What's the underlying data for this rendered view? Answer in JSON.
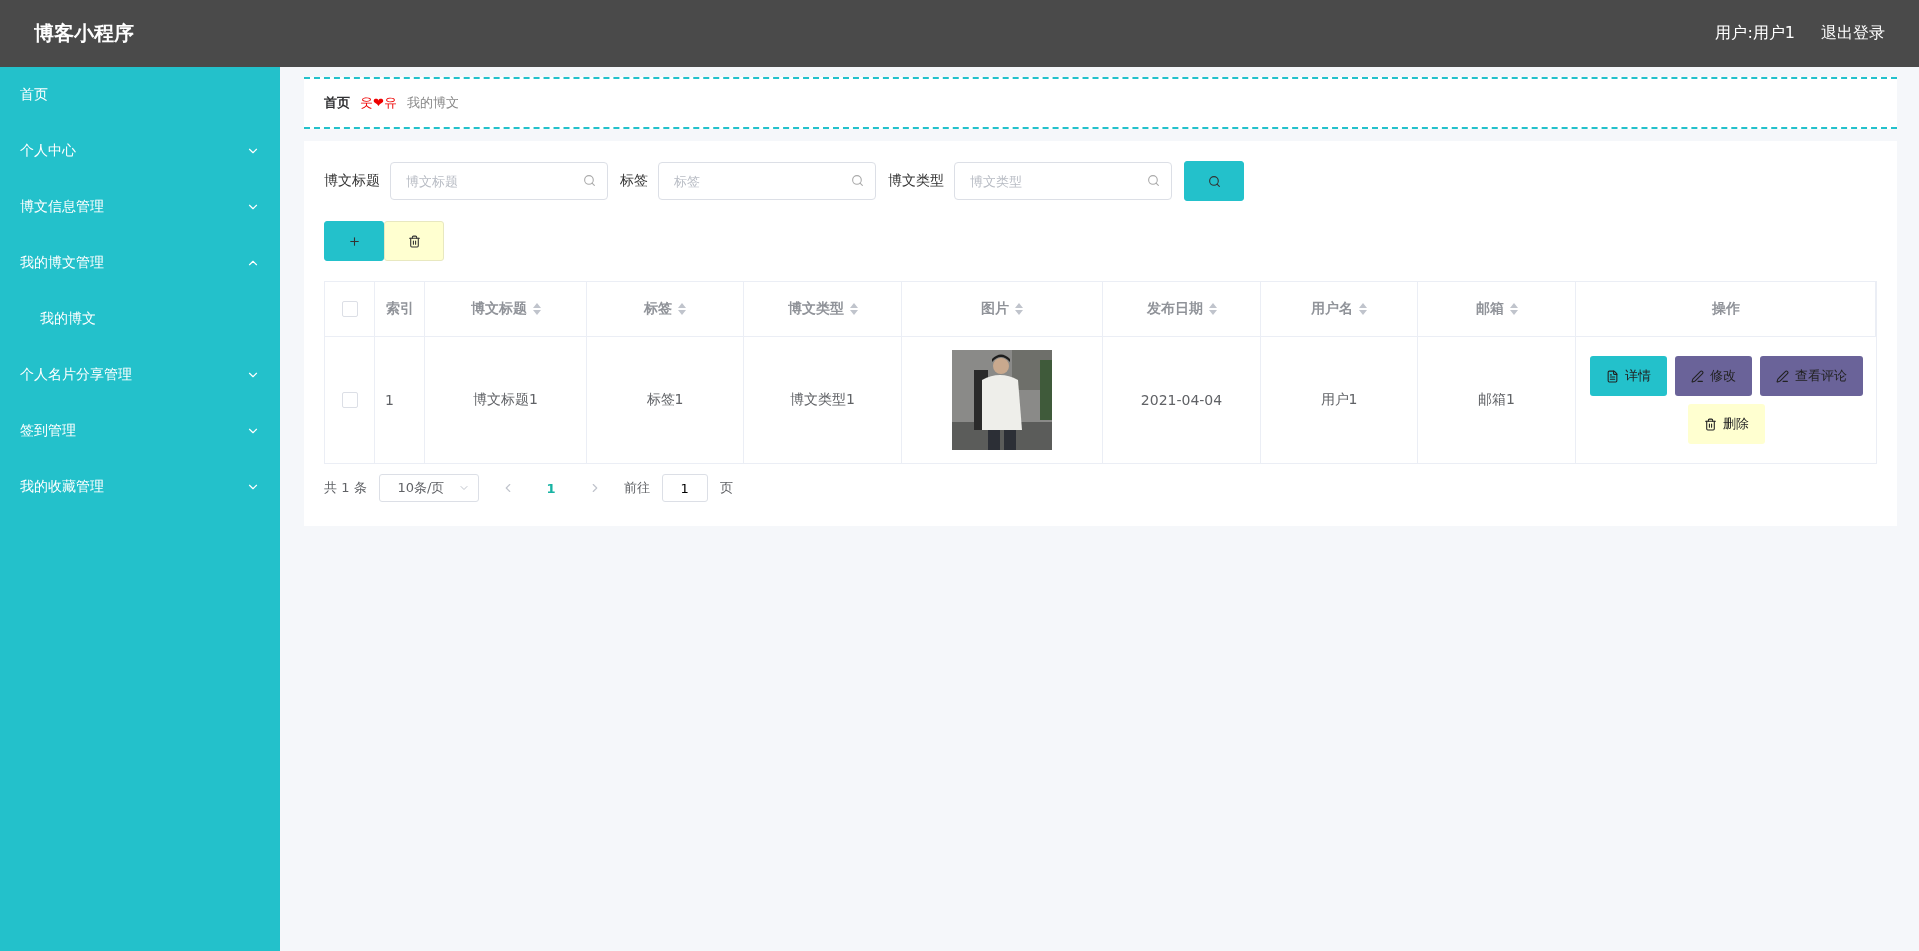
{
  "header": {
    "title": "博客小程序",
    "user": "用户:用户1",
    "logout": "退出登录"
  },
  "sidebar": {
    "items": [
      {
        "label": "首页"
      },
      {
        "label": "个人中心",
        "expandable": true,
        "expanded": false
      },
      {
        "label": "博文信息管理",
        "expandable": true,
        "expanded": false
      },
      {
        "label": "我的博文管理",
        "expandable": true,
        "expanded": true,
        "children": [
          {
            "label": "我的博文"
          }
        ]
      },
      {
        "label": "个人名片分享管理",
        "expandable": true,
        "expanded": false
      },
      {
        "label": "签到管理",
        "expandable": true,
        "expanded": false
      },
      {
        "label": "我的收藏管理",
        "expandable": true,
        "expanded": false
      }
    ]
  },
  "breadcrumb": {
    "home": "首页",
    "separator": "웃❤유",
    "current": "我的博文"
  },
  "search": {
    "fields": [
      {
        "label": "博文标题",
        "placeholder": "博文标题"
      },
      {
        "label": "标签",
        "placeholder": "标签"
      },
      {
        "label": "博文类型",
        "placeholder": "博文类型"
      }
    ]
  },
  "table": {
    "all_checked": false,
    "columns": [
      {
        "label": "索引",
        "sortable": false
      },
      {
        "label": "博文标题",
        "sortable": true
      },
      {
        "label": "标签",
        "sortable": true
      },
      {
        "label": "博文类型",
        "sortable": true
      },
      {
        "label": "图片",
        "sortable": true
      },
      {
        "label": "发布日期",
        "sortable": true
      },
      {
        "label": "用户名",
        "sortable": true
      },
      {
        "label": "邮箱",
        "sortable": true
      },
      {
        "label": "操作",
        "sortable": false
      }
    ],
    "rows": [
      {
        "checked": false,
        "cells": [
          "1",
          "博文标题1",
          "标签1",
          "博文类型1",
          {
            "kind": "picture"
          },
          "2021-04-04",
          "用户1",
          "邮箱1"
        ],
        "actions": [
          {
            "label": "详情",
            "kind": "detail"
          },
          {
            "label": "修改",
            "kind": "edit"
          },
          {
            "label": "查看评论",
            "kind": "edit"
          },
          {
            "label": "删除",
            "kind": "delete"
          }
        ]
      }
    ]
  },
  "pagination": {
    "total": "共 1 条",
    "page_size": "10条/页",
    "pages": [
      {
        "label": "1",
        "selected": true
      }
    ],
    "goto_label": "前往",
    "goto_value": "1",
    "goto_suffix": "页"
  }
}
